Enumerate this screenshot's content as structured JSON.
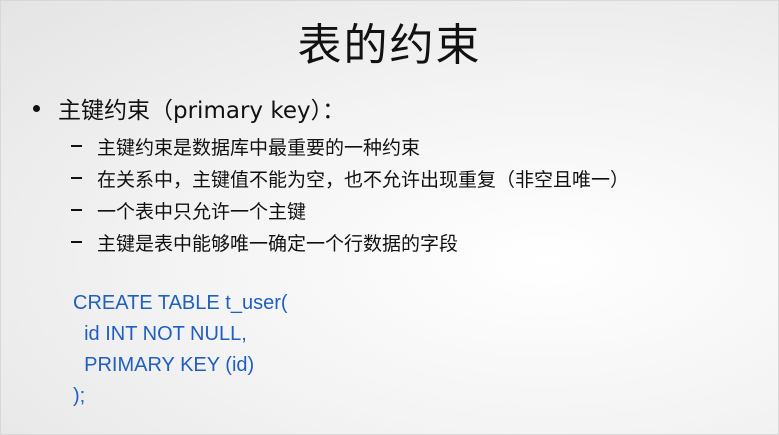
{
  "slide": {
    "title": "表的约束",
    "main_bullet": "主键约束（primary key）：",
    "sub_bullets": [
      "主键约束是数据库中最重要的一种约束",
      "在关系中，主键值不能为空，也不允许出现重复（非空且唯一）",
      "一个表中只允许一个主键",
      "主键是表中能够唯一确定一个行数据的字段"
    ],
    "code_lines": [
      "CREATE TABLE t_user(",
      "  id INT NOT NULL,",
      "  PRIMARY KEY (id)",
      ");"
    ],
    "code_color": "#1f5fbf"
  }
}
